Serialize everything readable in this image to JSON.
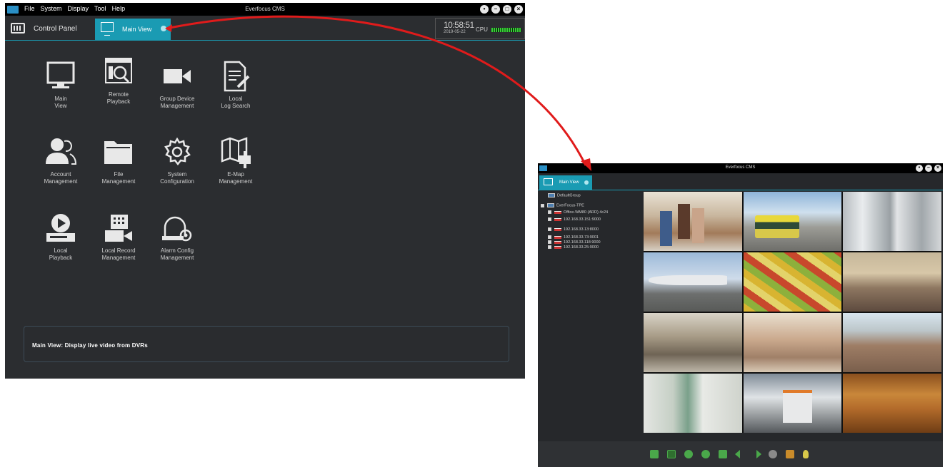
{
  "main_window": {
    "menu": [
      "File",
      "System",
      "Display",
      "Tool",
      "Help"
    ],
    "title": "Everfocus CMS",
    "tabs": {
      "control_panel": "Control Panel",
      "main_view": "Main View"
    },
    "status": {
      "time": "10:58:51",
      "date": "2019-05-22",
      "cpu_label": "CPU"
    },
    "modules": [
      {
        "lines": [
          "Main",
          "View"
        ],
        "icon": "monitor-icon"
      },
      {
        "lines": [
          "Remote",
          "Playback"
        ],
        "icon": "remote-playback-icon"
      },
      {
        "lines": [
          "Group Device",
          "Management"
        ],
        "icon": "camera-icon"
      },
      {
        "lines": [
          "Local",
          "Log Search"
        ],
        "icon": "log-search-icon"
      },
      {
        "lines": [
          "Account",
          "Management"
        ],
        "icon": "account-icon"
      },
      {
        "lines": [
          "File",
          "Management"
        ],
        "icon": "folder-icon"
      },
      {
        "lines": [
          "System",
          "Configuration"
        ],
        "icon": "gear-icon"
      },
      {
        "lines": [
          "E-Map",
          "Management"
        ],
        "icon": "map-icon"
      },
      {
        "lines": [
          "Local",
          "Playback"
        ],
        "icon": "local-playback-icon"
      },
      {
        "lines": [
          "Local Record",
          "Management"
        ],
        "icon": "record-icon"
      },
      {
        "lines": [
          "Alarm Config",
          "Management"
        ],
        "icon": "alarm-icon"
      }
    ],
    "info_text": "Main View: Display live video from DVRs"
  },
  "view_window": {
    "title": "Everfocus CMS",
    "tab_label": "Main View",
    "tree": {
      "default_group": "DefaultGroup",
      "group": "EverFocus-TPE",
      "devices": [
        "Office-WM80 (ARD) 4c24",
        "192.168.33.151:9000",
        "192.168.33.13:8000",
        "192.168.33.73:9001",
        "192.168.33.118:9000",
        "192.168.33.25:9000"
      ]
    }
  },
  "colors": {
    "accent": "#1a9bb3",
    "arrow": "#e01b1b"
  }
}
